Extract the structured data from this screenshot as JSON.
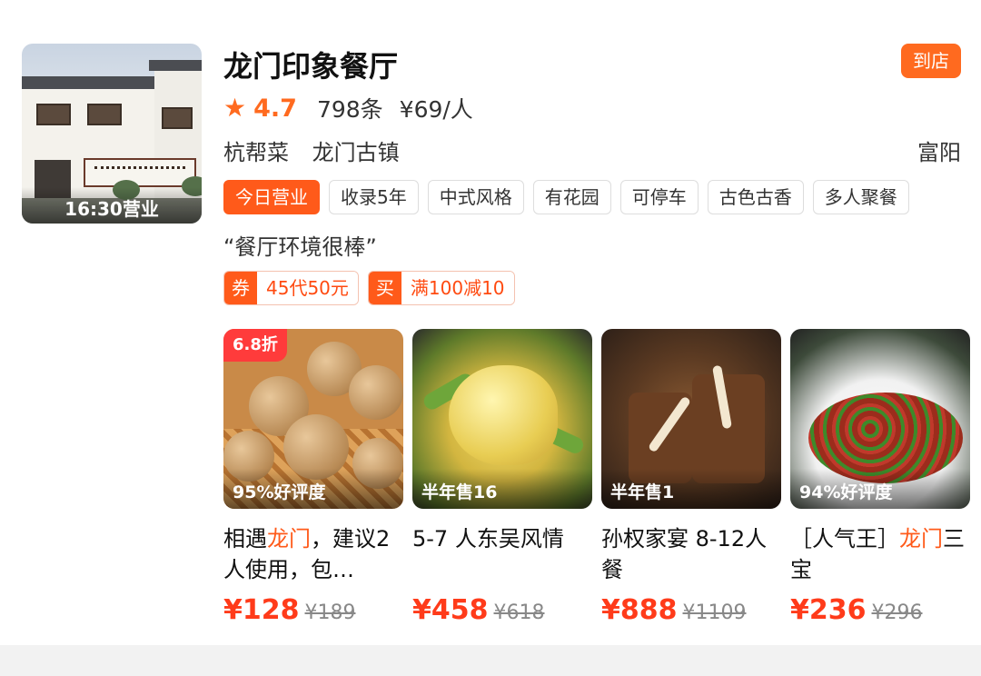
{
  "store": {
    "name": "龙门印象餐厅",
    "open_label": "16:30营业",
    "store_badge": "到店",
    "star_icon": "star-icon",
    "rating": "4.7",
    "review_count": "798条",
    "avg_price": "¥69/人",
    "cuisine": "杭帮菜",
    "area": "龙门古镇",
    "district": "富阳",
    "tags": [
      "今日营业",
      "收录5年",
      "中式风格",
      "有花园",
      "可停车",
      "古色古香",
      "多人聚餐"
    ],
    "quote": "“餐厅环境很棒”"
  },
  "deals": [
    {
      "badge": "券",
      "text": "45代50元"
    },
    {
      "badge": "买",
      "text": "满100减10"
    }
  ],
  "items": [
    {
      "discount": "6.8折",
      "overlay": "95%好评度",
      "name_hl_pre": "相遇",
      "name_hl": "龙门",
      "name_post": "，建议2人使用，包…",
      "price": "¥128",
      "orig_price": "¥189"
    },
    {
      "discount": "",
      "overlay": "半年售16",
      "name_hl_pre": "5-7 人东吴风情",
      "name_hl": "",
      "name_post": "",
      "price": "¥458",
      "orig_price": "¥618"
    },
    {
      "discount": "",
      "overlay": "半年售1",
      "name_hl_pre": "孙权家宴 8-12人餐",
      "name_hl": "",
      "name_post": "",
      "price": "¥888",
      "orig_price": "¥1109"
    },
    {
      "discount": "",
      "overlay": "94%好评度",
      "name_hl_pre": "［人气王］",
      "name_hl": "龙门",
      "name_post": "三宝",
      "price": "¥236",
      "orig_price": "¥296"
    }
  ],
  "colors": {
    "accent": "#ff5a1a",
    "price": "#ff3b1a",
    "discount": "#ff3b3b"
  }
}
